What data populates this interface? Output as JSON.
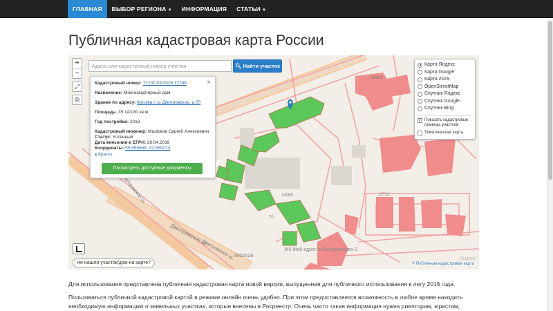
{
  "nav": {
    "items": [
      {
        "label": "ГЛАВНАЯ"
      },
      {
        "label": "ВЫБОР РЕГИОНА"
      },
      {
        "label": "ИНФОРМАЦИЯ"
      },
      {
        "label": "СТАТЬИ"
      }
    ]
  },
  "page": {
    "title": "Публичная кадастровая карта России"
  },
  "map": {
    "zoom_in": "+",
    "zoom_out": "−",
    "search_placeholder": "Адрес или кадастровый номер участка",
    "search_button": "Найти участок",
    "popup": {
      "close": "×",
      "cad_number_label": "Кадастровый номер:",
      "cad_number_value": "77:09:0002026:17296",
      "purpose_label": "Назначение:",
      "purpose_value": "Многоквартирный дом",
      "address_label": "Здание по адресу:",
      "address_value": "Москва г, ш Дмитровское, д 70",
      "area_label": "Площадь:",
      "area_value": "35 143.80 кв.м",
      "year_label": "Год постройки:",
      "year_value": "2018",
      "engineer_label": "Кадастровый инженер:",
      "engineer_value": "Малюков Сергей Алексеевич",
      "status_label": "Статус:",
      "status_value": "Учтенный",
      "egrn_label": "Дата внесения в ЕГРН:",
      "egrn_value": "26.04.2019",
      "coords_label": "Координаты:",
      "coords_value": "55.859868, 37.559273",
      "short_link": "Кратко",
      "docs_button": "Посмотреть доступные документы"
    },
    "layers": {
      "options": [
        {
          "label": "Карта Яндекс",
          "selected": true
        },
        {
          "label": "Карта Google",
          "selected": false
        },
        {
          "label": "Карта 2GIS",
          "selected": false
        },
        {
          "label": "OpenStreetMap",
          "selected": false
        },
        {
          "label": "Спутник Яндекс",
          "selected": false
        },
        {
          "label": "Спутник Google",
          "selected": false
        },
        {
          "label": "Спутник Bing",
          "selected": false
        }
      ],
      "show_borders": "Показать кадастровые границы участков",
      "thematic": "Тематическая карта"
    },
    "not_found": "Не нашли участок/дом на карте?",
    "copyright": "© Публичная кадастровая карта",
    "labels": {
      "street1": "Дмитровское ш.",
      "street2": "Дмитровское ш.",
      "street3": "Дмитровское ш.",
      "quarter": "0002026",
      "complex": "ЖК Мой адрес в Бескудниково-2",
      "lot1": "14069",
      "lot2": "14069",
      "lot3": "12711",
      "lot4": "70"
    },
    "colors": {
      "building_red": "#f08c8c",
      "building_green": "#5cc85c",
      "marker": "#2b7fc8"
    }
  },
  "content": {
    "p1": "Для использования представлена публичная кадастровая карта новой версии, выпущенная для публичного использования к лету 2016 года.",
    "p2": "Пользоваться публичной кадастровой картой в режиме онлайн очень удобно. При этом предоставляется возможность в любое время находить необходимую информацию о земельных участках, которые внесены в Росреестр. Очень часто такая информация нужна риелторам, юристам,"
  }
}
